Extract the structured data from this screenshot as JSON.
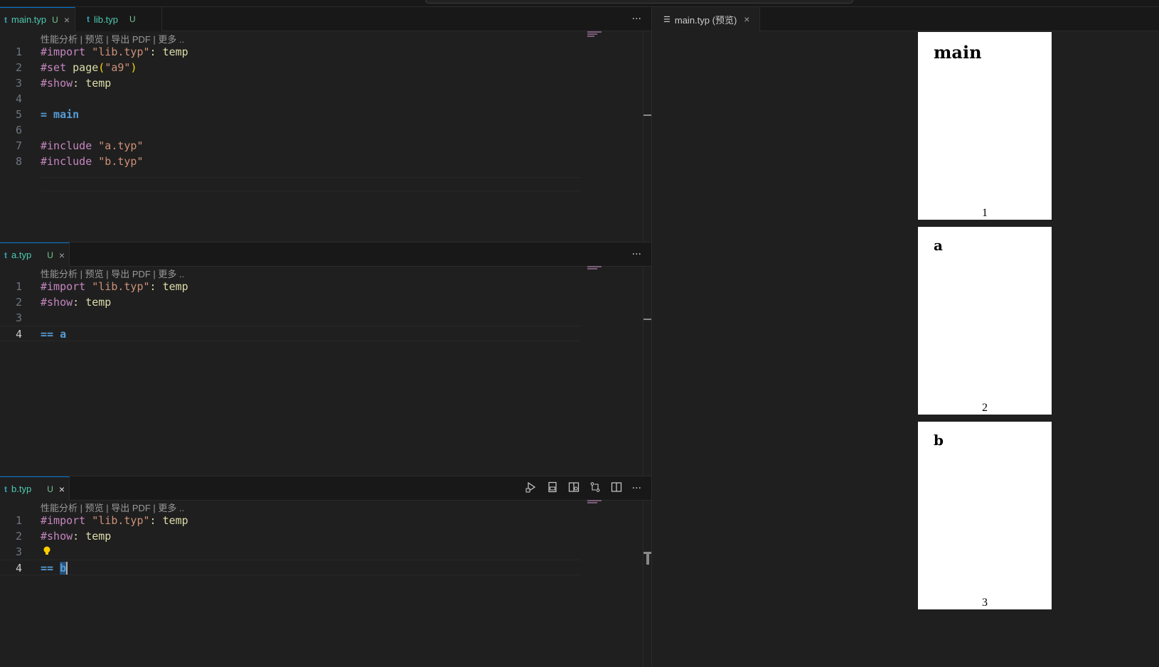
{
  "codelens": "性能分析 | 预览 | 导出 PDF | 更多 ..",
  "groups": [
    {
      "tabs": [
        {
          "icon": "t",
          "label": "main.typ",
          "status": "U",
          "close": "×"
        },
        {
          "icon": "t",
          "label": "lib.typ",
          "status": "U"
        }
      ],
      "more": "···",
      "lines": [
        "1",
        "2",
        "3",
        "4",
        "5",
        "6",
        "7",
        "8"
      ]
    },
    {
      "tabs": [
        {
          "icon": "t",
          "label": "a.typ",
          "status": "U",
          "close": "×"
        }
      ],
      "more": "···",
      "lines": [
        "1",
        "2",
        "3",
        "4"
      ]
    },
    {
      "tabs": [
        {
          "icon": "t",
          "label": "b.typ",
          "status": "U",
          "close": "×"
        }
      ],
      "more": "···",
      "lines": [
        "1",
        "2",
        "3",
        "4"
      ]
    }
  ],
  "code": {
    "import_kw": "#import",
    "import_str": "\"lib.typ\"",
    "colon_temp": ": temp",
    "set_kw": "#set",
    "page_fn": "page",
    "paren_open": "(",
    "a9_str": "\"a9\"",
    "paren_close": ")",
    "show_kw": "#show",
    "main_heading": "= main",
    "include_kw": "#include",
    "a_str": "\"a.typ\"",
    "b_str": "\"b.typ\"",
    "a_heading_marker": "==",
    "a_heading_text": "a",
    "b_heading_marker": "==",
    "b_heading_text": "b"
  },
  "preview": {
    "tab_label": "main.typ (预览)",
    "close": "×",
    "pages": [
      {
        "heading": "main",
        "number": "1"
      },
      {
        "heading": "a",
        "number": "2"
      },
      {
        "heading": "b",
        "number": "3"
      }
    ]
  }
}
